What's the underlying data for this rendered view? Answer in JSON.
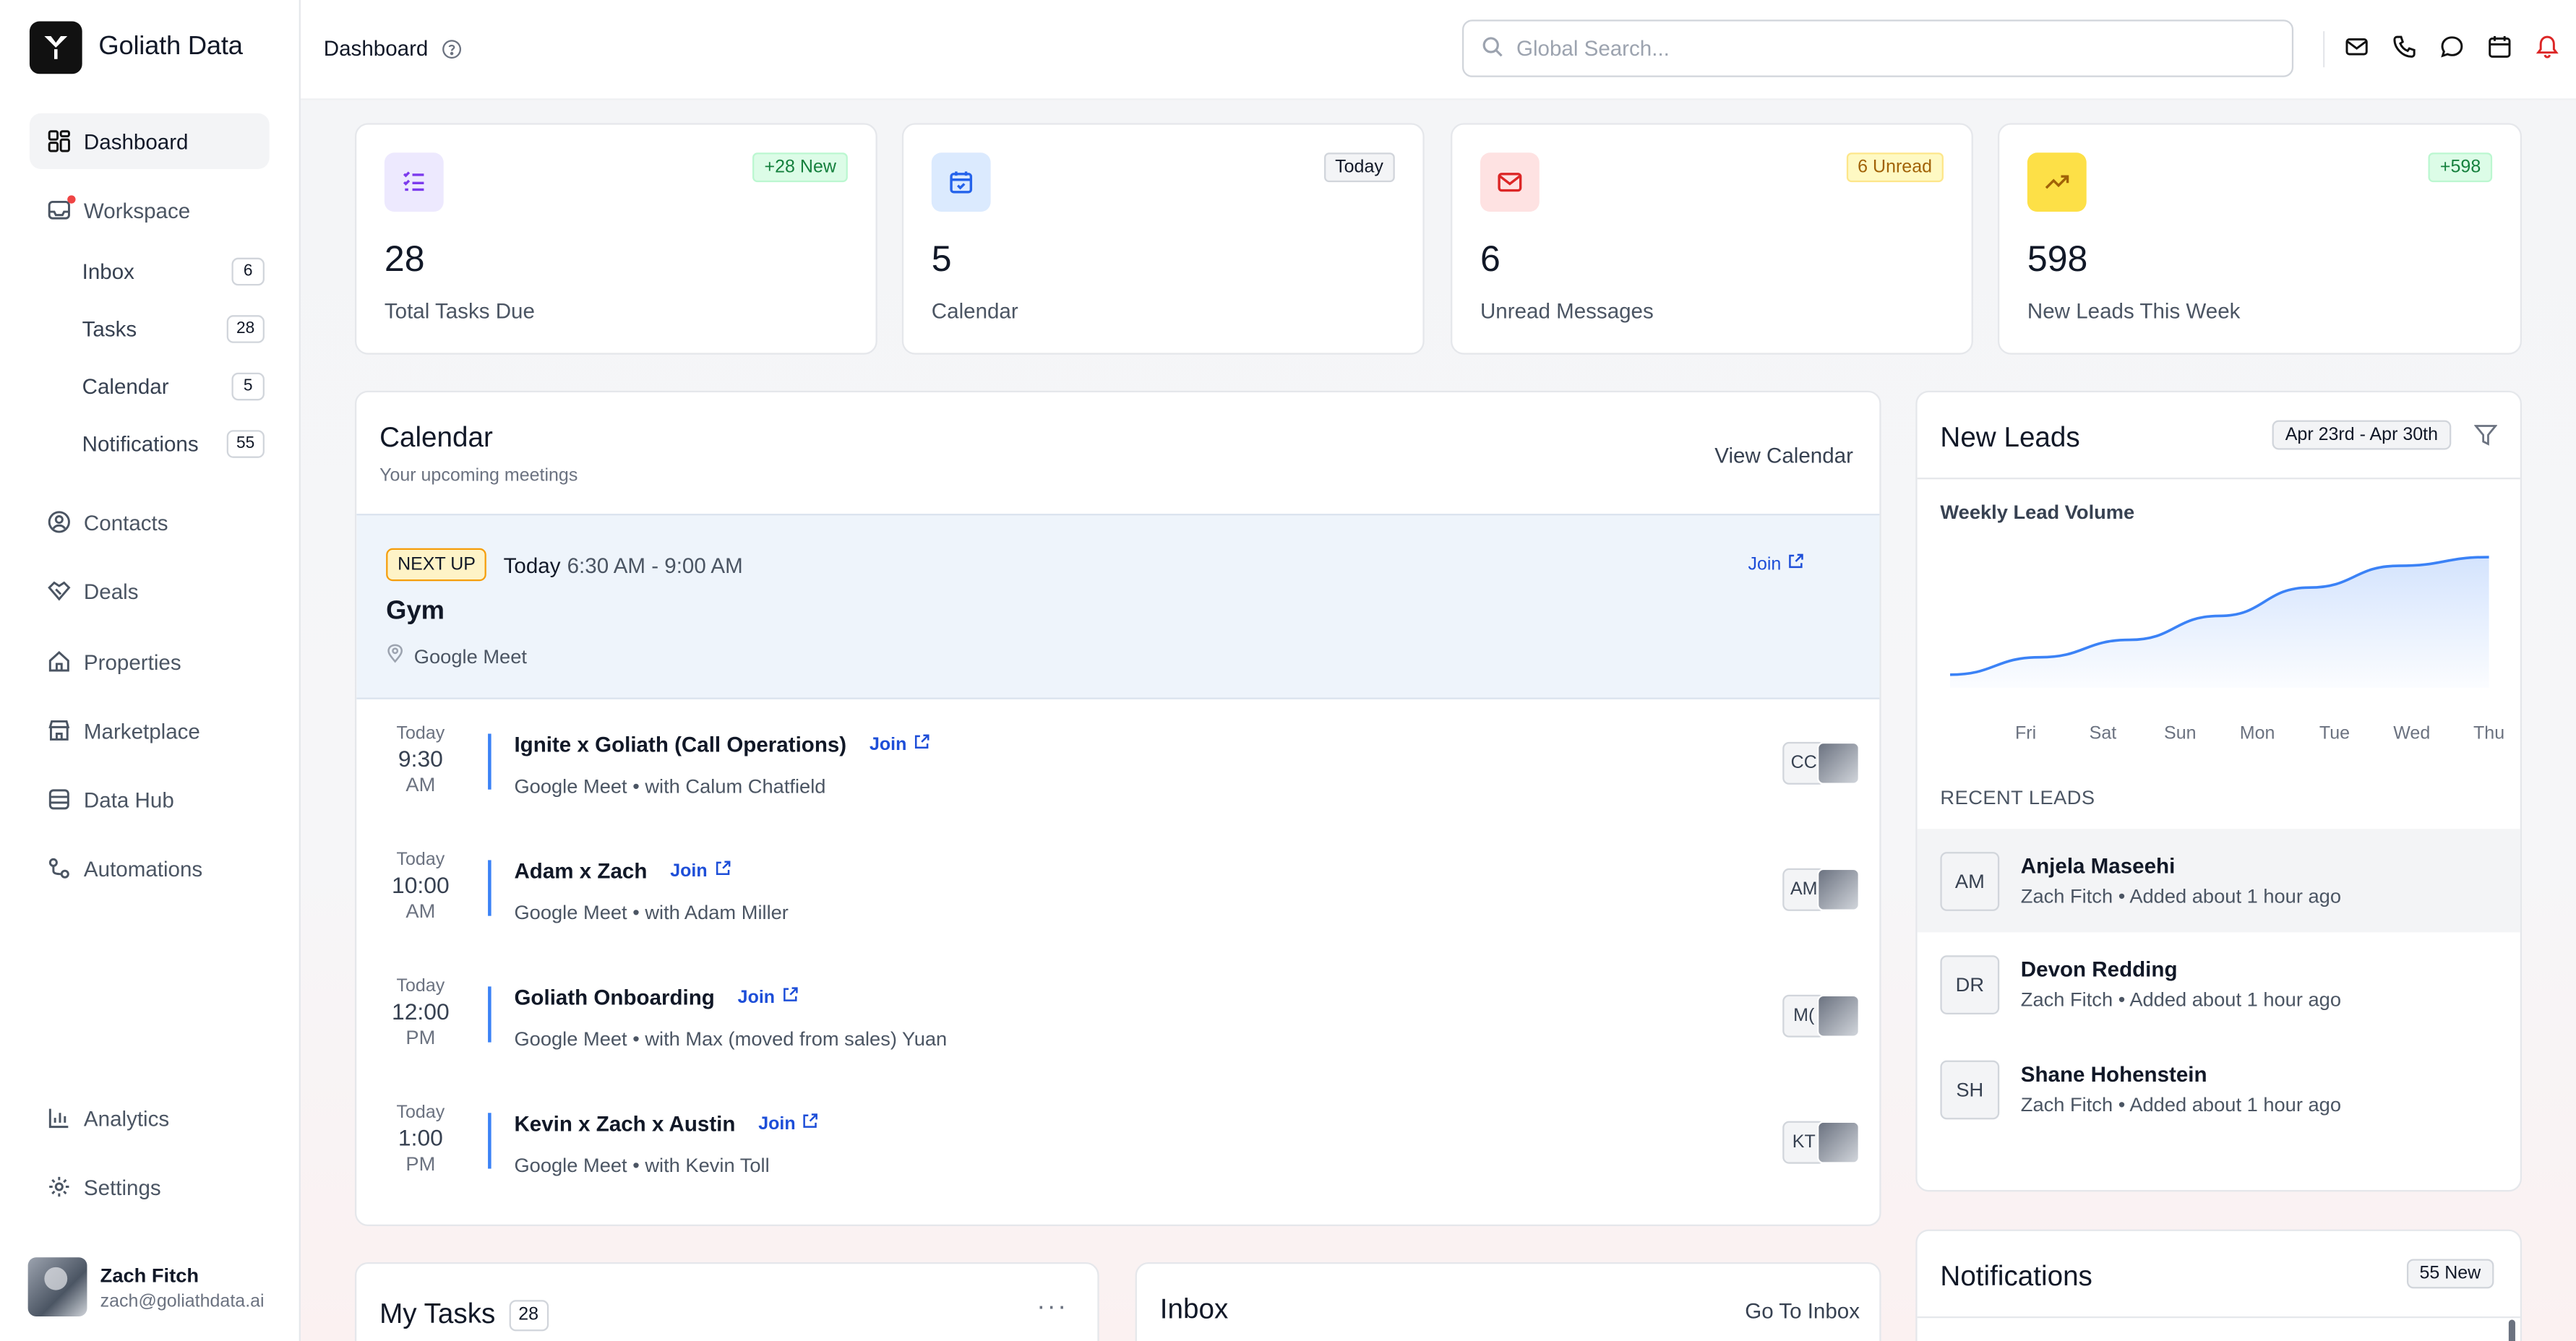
{
  "brand": {
    "name": "Goliath Data"
  },
  "sidebar": {
    "items": [
      {
        "label": "Dashboard",
        "icon": "grid-icon"
      },
      {
        "label": "Workspace",
        "icon": "inbox-tray-icon"
      },
      {
        "label": "Contacts",
        "icon": "user-circle-icon"
      },
      {
        "label": "Deals",
        "icon": "handshake-icon"
      },
      {
        "label": "Properties",
        "icon": "home-icon"
      },
      {
        "label": "Marketplace",
        "icon": "store-icon"
      },
      {
        "label": "Data Hub",
        "icon": "database-icon"
      },
      {
        "label": "Automations",
        "icon": "workflow-icon"
      },
      {
        "label": "Analytics",
        "icon": "bar-chart-icon"
      },
      {
        "label": "Settings",
        "icon": "gear-icon"
      }
    ],
    "workspace_items": [
      {
        "label": "Inbox",
        "count": "6"
      },
      {
        "label": "Tasks",
        "count": "28"
      },
      {
        "label": "Calendar",
        "count": "5"
      },
      {
        "label": "Notifications",
        "count": "55"
      }
    ],
    "user": {
      "name": "Zach Fitch",
      "email": "zach@goliathdata.ai"
    }
  },
  "header": {
    "title": "Dashboard",
    "search_placeholder": "Global Search..."
  },
  "stats": [
    {
      "value": "28",
      "label": "Total Tasks Due",
      "badge": "+28 New",
      "icon": "checklist-icon"
    },
    {
      "value": "5",
      "label": "Calendar",
      "badge": "Today",
      "icon": "calendar-check-icon"
    },
    {
      "value": "6",
      "label": "Unread Messages",
      "badge": "6 Unread",
      "icon": "mail-icon"
    },
    {
      "value": "598",
      "label": "New Leads This Week",
      "badge": "+598",
      "icon": "trending-up-icon"
    }
  ],
  "calendar": {
    "title": "Calendar",
    "subtitle": "Your upcoming meetings",
    "view_link": "View Calendar",
    "next_up": {
      "badge": "NEXT UP",
      "day": "Today",
      "time": "6:30 AM - 9:00 AM",
      "title": "Gym",
      "location": "Google Meet",
      "join": "Join"
    },
    "meetings": [
      {
        "day": "Today",
        "time": "9:30",
        "ampm": "AM",
        "title": "Ignite x Goliath (Call Operations)",
        "join": "Join",
        "detail": "Google Meet • with Calum Chatfield",
        "initials": "CC"
      },
      {
        "day": "Today",
        "time": "10:00",
        "ampm": "AM",
        "title": "Adam x Zach",
        "join": "Join",
        "detail": "Google Meet • with Adam Miller",
        "initials": "AM"
      },
      {
        "day": "Today",
        "time": "12:00",
        "ampm": "PM",
        "title": "Goliath Onboarding",
        "join": "Join",
        "detail": "Google Meet • with Max (moved from sales) Yuan",
        "initials": "M("
      },
      {
        "day": "Today",
        "time": "1:00",
        "ampm": "PM",
        "title": "Kevin x Zach x Austin",
        "join": "Join",
        "detail": "Google Meet • with Kevin Toll",
        "initials": "KT"
      }
    ]
  },
  "leads": {
    "title": "New Leads",
    "date_range": "Apr 23rd - Apr 30th",
    "chart_title": "Weekly Lead Volume",
    "recent_header": "RECENT LEADS",
    "recent": [
      {
        "initials": "AM",
        "name": "Anjela Maseehi",
        "detail": "Zach Fitch • Added about 1 hour ago"
      },
      {
        "initials": "DR",
        "name": "Devon Redding",
        "detail": "Zach Fitch • Added about 1 hour ago"
      },
      {
        "initials": "SH",
        "name": "Shane Hohenstein",
        "detail": "Zach Fitch • Added about 1 hour ago"
      }
    ]
  },
  "chart_data": {
    "type": "area",
    "title": "Weekly Lead Volume",
    "categories": [
      "Fri",
      "Sat",
      "Sun",
      "Mon",
      "Tue",
      "Wed",
      "Thu"
    ],
    "values": [
      12,
      28,
      44,
      66,
      92,
      112,
      120
    ],
    "grid": false,
    "color": "#3b82f6"
  },
  "tasks": {
    "title": "My Tasks",
    "count": "28",
    "more": "···"
  },
  "inbox": {
    "title": "Inbox",
    "link": "Go To Inbox"
  },
  "notifications": {
    "title": "Notifications",
    "badge": "55 New"
  },
  "colors": {
    "accent": "#1d4ed8",
    "green_badge": "#16a34a",
    "amber_badge": "#ca8a04",
    "red_icon": "#dc2626"
  }
}
